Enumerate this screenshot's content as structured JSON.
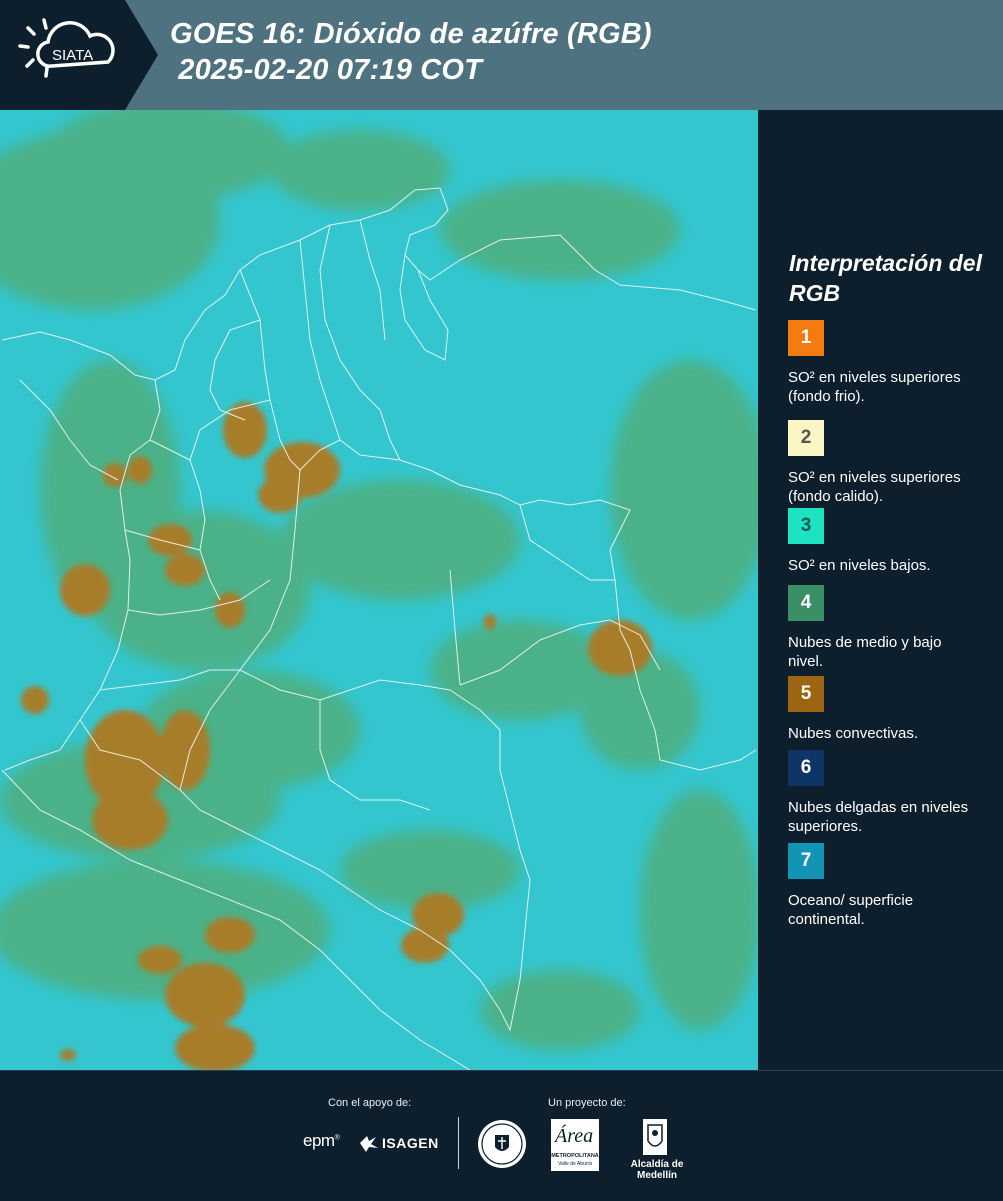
{
  "header": {
    "logo_text": "SIATA",
    "title_line1": "GOES 16: Dióxido de azúfre (RGB)",
    "title_line2": " 2025-02-20 07:19 COT"
  },
  "legend": {
    "title": "Interpretación del RGB",
    "items": [
      {
        "number": "1",
        "label": "SO² en niveles superiores (fondo frio).",
        "color": "#f47b10",
        "text_color": "#ffffff"
      },
      {
        "number": "2",
        "label": "SO² en niveles superiores (fondo calido).",
        "color": "#fcf6c4",
        "text_color": "#555555"
      },
      {
        "number": "3",
        "label": "SO² en niveles bajos.",
        "color": "#1de3c3",
        "text_color": "#1a5a52"
      },
      {
        "number": "4",
        "label": "Nubes de medio y bajo nivel.",
        "color": "#3a8f64",
        "text_color": "#ffffff"
      },
      {
        "number": "5",
        "label": "Nubes convectivas.",
        "color": "#9b6512",
        "text_color": "#ffffff"
      },
      {
        "number": "6",
        "label": "Nubes delgadas en niveles superiores.",
        "color": "#0d3566",
        "text_color": "#ffffff"
      },
      {
        "number": "7",
        "label": "Oceano/ superficie continental.",
        "color": "#1295b5",
        "text_color": "#ffffff"
      }
    ]
  },
  "footer": {
    "support_label": "Con el apoyo de:",
    "project_label": "Un proyecto de:",
    "epm": "epm",
    "isagen": "ISAGEN",
    "area_metropolitana": "Área",
    "area_sub": "METROPOLITANA",
    "area_sub2": "Valle de Aburrá",
    "alcaldia": "Alcaldía de Medellín"
  },
  "colors": {
    "header_bg": "#4e7280",
    "logo_bg": "#0d1f2d",
    "sidebar_bg": "#0d1f2d",
    "ocean": "#33c6cf",
    "low_cloud": "#4fae7c",
    "convective": "#a87d2c"
  }
}
